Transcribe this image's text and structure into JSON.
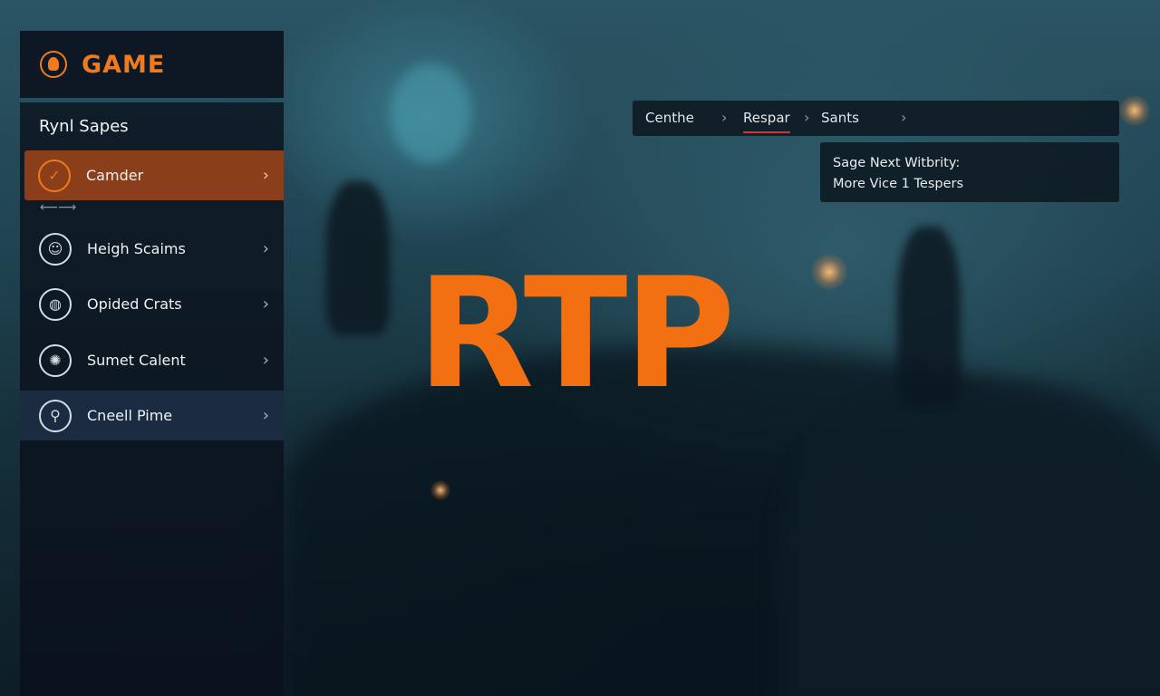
{
  "brand": {
    "logo_text": "GAME",
    "accent": "#f07a1c"
  },
  "sidebar": {
    "title": "Rynl Sapes",
    "items": [
      {
        "label": "Camder",
        "icon": "checkmark-icon",
        "state": "active"
      },
      {
        "label": "Heigh Scaims",
        "icon": "head-profile-icon",
        "state": "normal"
      },
      {
        "label": "Opided Crats",
        "icon": "globe-icon",
        "state": "normal"
      },
      {
        "label": "Sumet Calent",
        "icon": "brain-icon",
        "state": "normal"
      },
      {
        "label": "Cneell Pime",
        "icon": "microphone-icon",
        "state": "selected"
      }
    ]
  },
  "breadcrumb": {
    "items": [
      {
        "label": "Centhe",
        "active": false
      },
      {
        "label": "Respar",
        "active": true
      },
      {
        "label": "Sants",
        "active": false
      }
    ]
  },
  "info_panel": {
    "line1": "Sage Next Witbrity:",
    "line2": "More Vice 1 Tespers"
  },
  "hero": {
    "text": "RTP",
    "color": "#f26f12"
  }
}
